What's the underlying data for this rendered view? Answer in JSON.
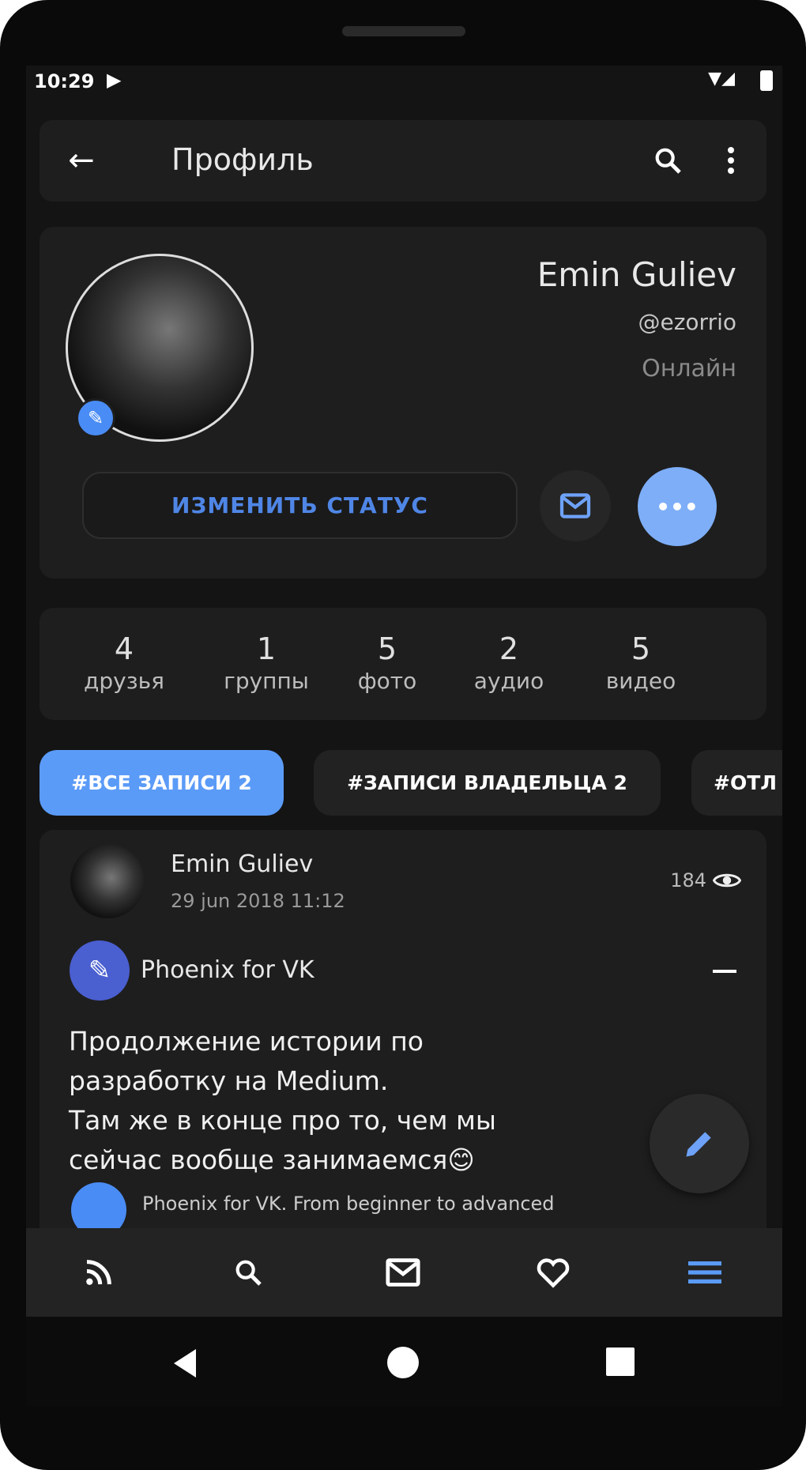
{
  "status_bar": {
    "time": "10:29"
  },
  "toolbar": {
    "title": "Профиль"
  },
  "profile": {
    "name": "Emin Guliev",
    "handle": "@ezorrio",
    "status": "Онлайн",
    "change_status_label": "ИЗМЕНИТЬ СТАТУС"
  },
  "counters": [
    {
      "value": "4",
      "label": "друзья"
    },
    {
      "value": "1",
      "label": "группы"
    },
    {
      "value": "5",
      "label": "фото"
    },
    {
      "value": "2",
      "label": "аудио"
    },
    {
      "value": "5",
      "label": "видео"
    }
  ],
  "filters": [
    {
      "label": "#ВСЕ ЗАПИСИ 2",
      "active": true
    },
    {
      "label": "#ЗАПИСИ ВЛАДЕЛЬЦА 2",
      "active": false
    },
    {
      "label": "#ОТЛ",
      "active": false
    }
  ],
  "post": {
    "author": "Emin Guliev",
    "date": "29 jun 2018 11:12",
    "views": "184",
    "repost_source": "Phoenix for VK",
    "text": "Продолжение истории по разработку на Medium.\nТам же в конце про то, чем мы сейчас вообще занимаемся😊",
    "link_preview": "Phoenix for VK. From beginner to advanced"
  },
  "bottom_nav": [
    "feed-icon",
    "search-icon",
    "mail-icon",
    "heart-icon",
    "menu-icon"
  ],
  "colors": {
    "accent": "#6ea2f8",
    "card": "#1e1e1e",
    "background": "#141414"
  }
}
